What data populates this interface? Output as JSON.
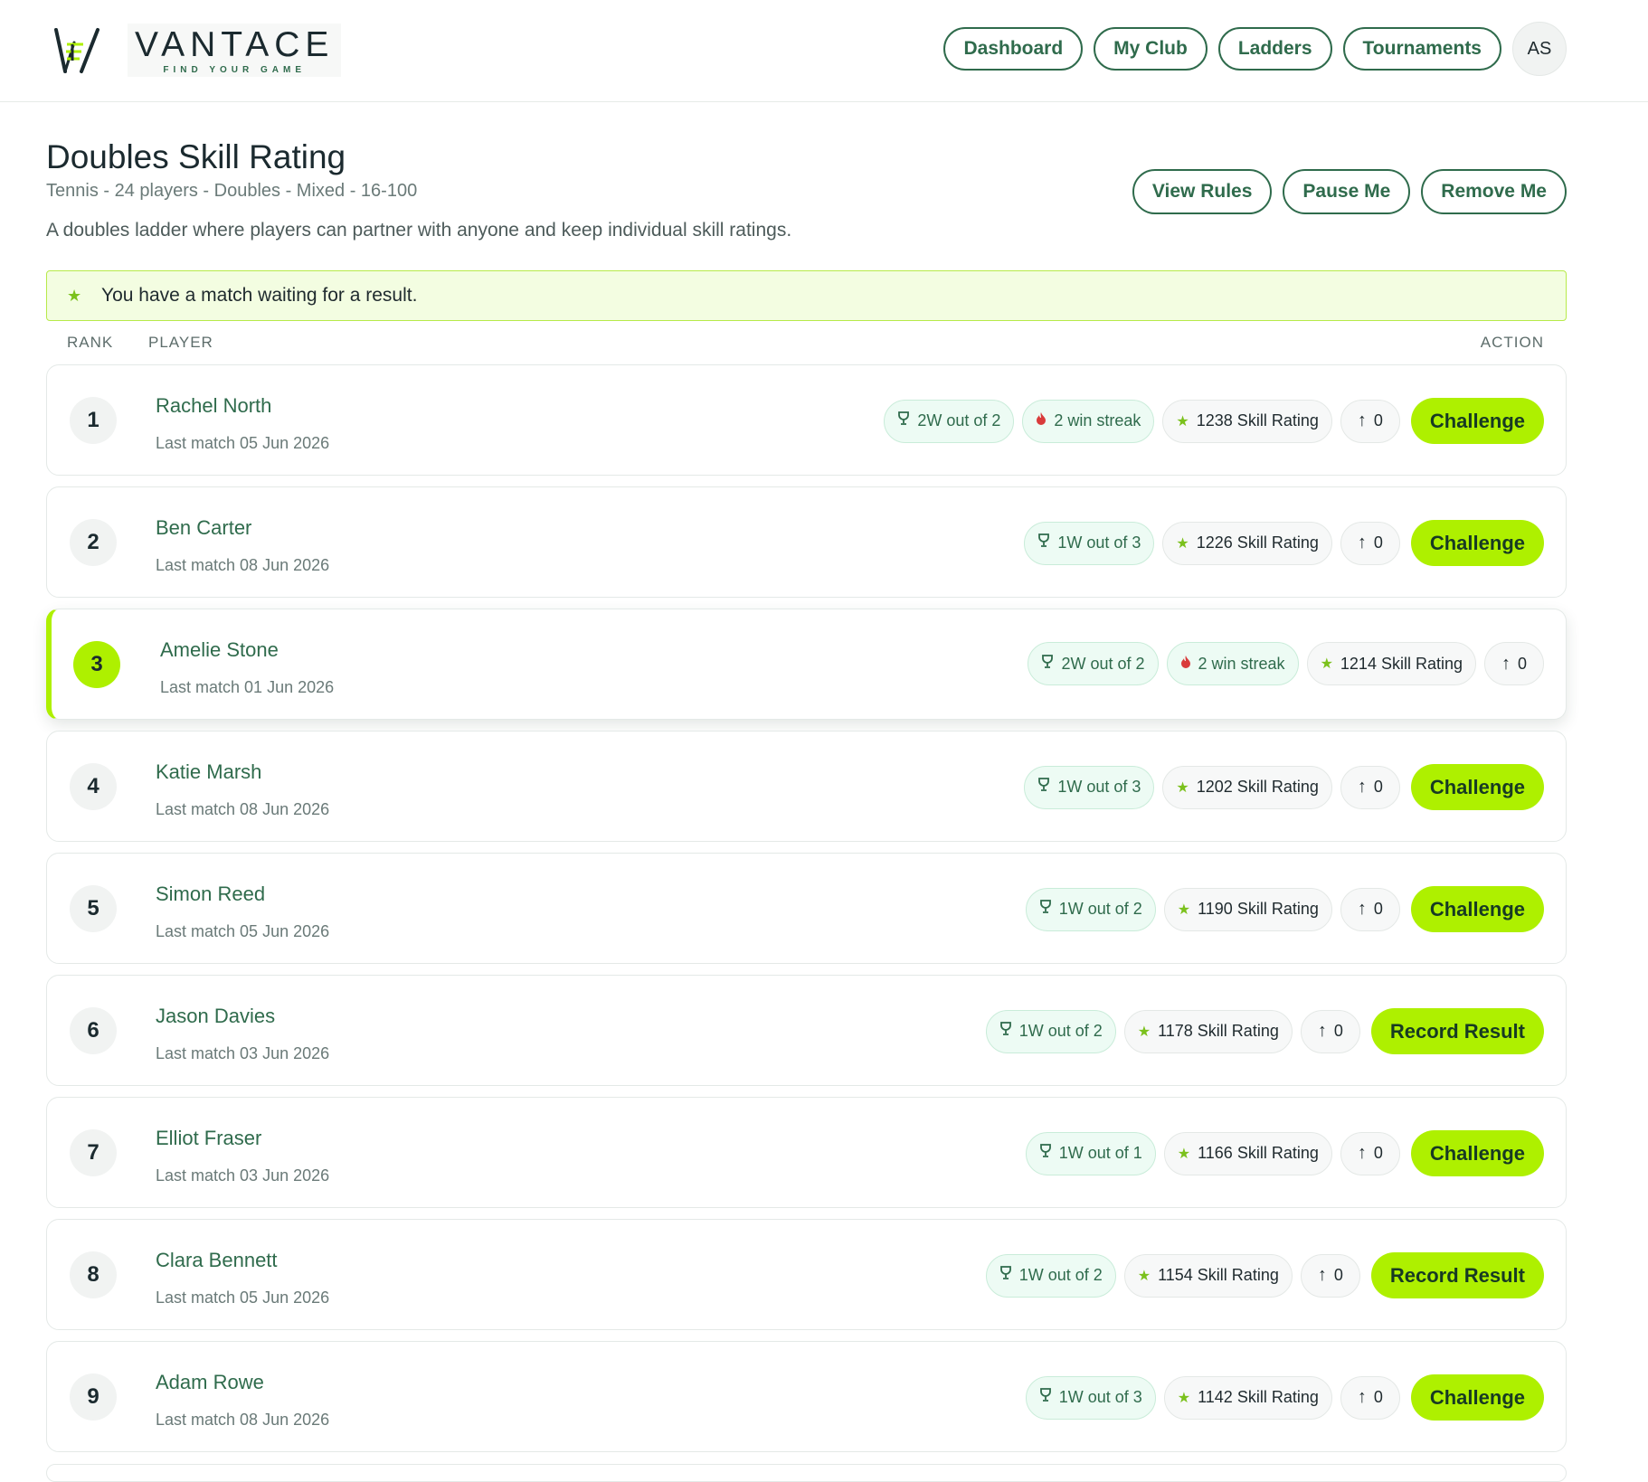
{
  "brand": {
    "name": "VANTACE",
    "tagline": "FIND YOUR GAME"
  },
  "nav": {
    "items": [
      "Dashboard",
      "My Club",
      "Ladders",
      "Tournaments"
    ],
    "avatar_initials": "AS"
  },
  "ladder": {
    "title": "Doubles Skill Rating",
    "subtitle": "Tennis - 24 players - Doubles - Mixed - 16-100",
    "description": "A doubles ladder where players can partner with anyone and keep individual skill ratings.",
    "actions": [
      "View Rules",
      "Pause Me",
      "Remove Me"
    ]
  },
  "notice": {
    "text": "You have a match waiting for a result.",
    "icon": "star-icon"
  },
  "columns": {
    "rank": "RANK",
    "player": "PLAYER",
    "action": "ACTION"
  },
  "colors": {
    "accent": "#aef000",
    "brand_green": "#2f6b4c",
    "notice_bg": "#f3fde1"
  },
  "players": [
    {
      "rank": "1",
      "name": "Rachel North",
      "last_match": "Last match 05 Jun 2026",
      "record": "2W out of 2",
      "streak": "2 win streak",
      "rating": "1238 Skill Rating",
      "movement": "0",
      "action": "Challenge",
      "is_me": false
    },
    {
      "rank": "2",
      "name": "Ben Carter",
      "last_match": "Last match 08 Jun 2026",
      "record": "1W out of 3",
      "streak": "",
      "rating": "1226 Skill Rating",
      "movement": "0",
      "action": "Challenge",
      "is_me": false
    },
    {
      "rank": "3",
      "name": "Amelie Stone",
      "last_match": "Last match 01 Jun 2026",
      "record": "2W out of 2",
      "streak": "2 win streak",
      "rating": "1214 Skill Rating",
      "movement": "0",
      "action": "",
      "is_me": true
    },
    {
      "rank": "4",
      "name": "Katie Marsh",
      "last_match": "Last match 08 Jun 2026",
      "record": "1W out of 3",
      "streak": "",
      "rating": "1202 Skill Rating",
      "movement": "0",
      "action": "Challenge",
      "is_me": false
    },
    {
      "rank": "5",
      "name": "Simon Reed",
      "last_match": "Last match 05 Jun 2026",
      "record": "1W out of 2",
      "streak": "",
      "rating": "1190 Skill Rating",
      "movement": "0",
      "action": "Challenge",
      "is_me": false
    },
    {
      "rank": "6",
      "name": "Jason Davies",
      "last_match": "Last match 03 Jun 2026",
      "record": "1W out of 2",
      "streak": "",
      "rating": "1178 Skill Rating",
      "movement": "0",
      "action": "Record Result",
      "is_me": false
    },
    {
      "rank": "7",
      "name": "Elliot Fraser",
      "last_match": "Last match 03 Jun 2026",
      "record": "1W out of 1",
      "streak": "",
      "rating": "1166 Skill Rating",
      "movement": "0",
      "action": "Challenge",
      "is_me": false
    },
    {
      "rank": "8",
      "name": "Clara Bennett",
      "last_match": "Last match 05 Jun 2026",
      "record": "1W out of 2",
      "streak": "",
      "rating": "1154 Skill Rating",
      "movement": "0",
      "action": "Record Result",
      "is_me": false
    },
    {
      "rank": "9",
      "name": "Adam Rowe",
      "last_match": "Last match 08 Jun 2026",
      "record": "1W out of 3",
      "streak": "",
      "rating": "1142 Skill Rating",
      "movement": "0",
      "action": "Challenge",
      "is_me": false
    }
  ]
}
